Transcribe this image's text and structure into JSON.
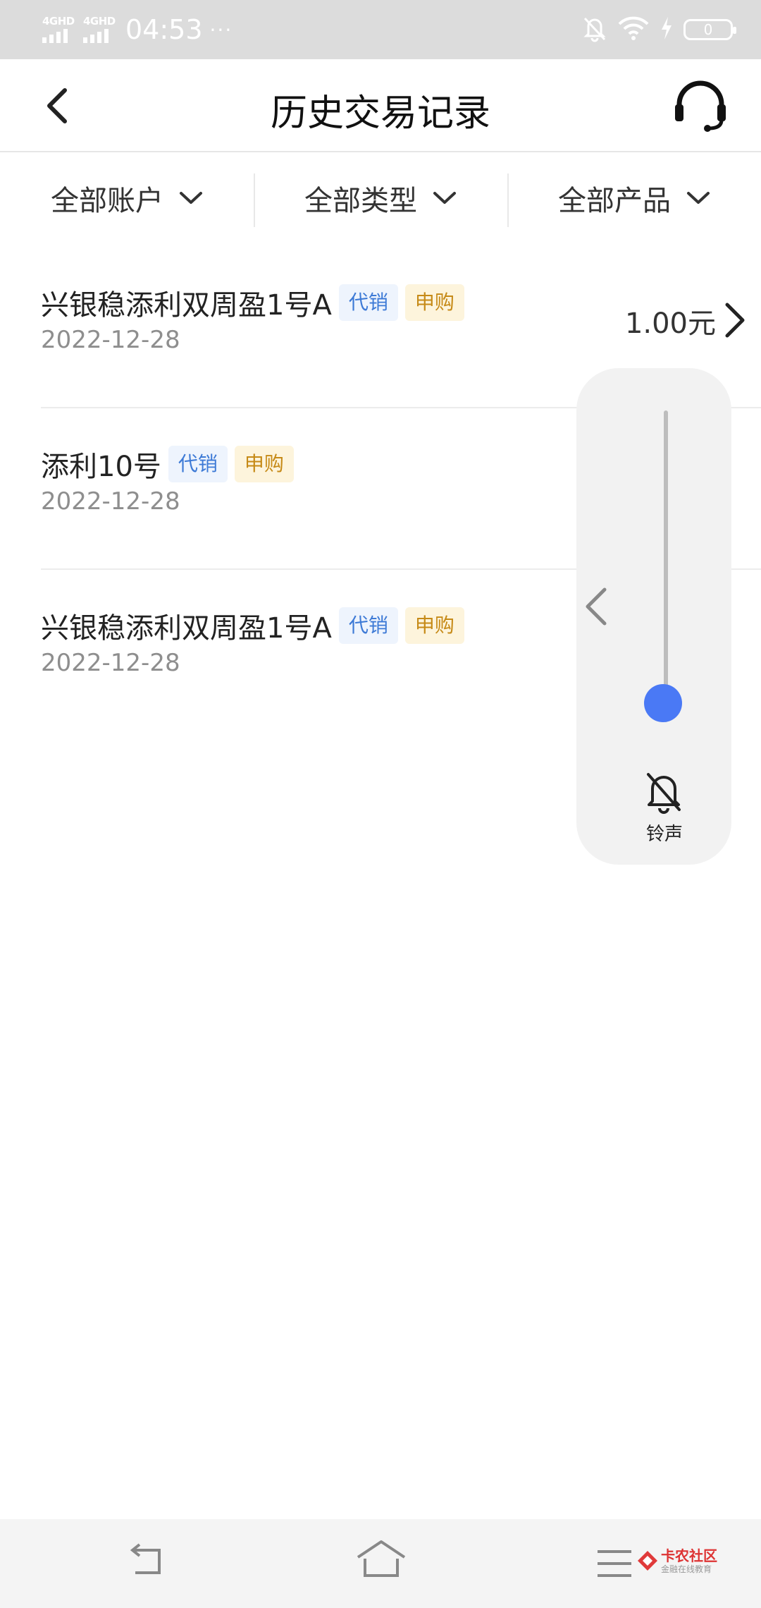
{
  "status_bar": {
    "network_1": "4GHD",
    "network_2": "4GHD",
    "time": "04:53",
    "more": "···",
    "battery": "0"
  },
  "header": {
    "title": "历史交易记录"
  },
  "filters": [
    {
      "label": "全部账户"
    },
    {
      "label": "全部类型"
    },
    {
      "label": "全部产品"
    }
  ],
  "records": [
    {
      "name": "兴银稳添利双周盈1号A",
      "tag_agent": "代销",
      "tag_type": "申购",
      "date": "2022-12-28",
      "amount": "1.00元"
    },
    {
      "name": "添利10号",
      "tag_agent": "代销",
      "tag_type": "申购",
      "date": "2022-12-28",
      "amount": ""
    },
    {
      "name": "兴银稳添利双周盈1号A",
      "tag_agent": "代销",
      "tag_type": "申购",
      "date": "2022-12-28",
      "amount": ""
    }
  ],
  "volume_overlay": {
    "label": "铃声",
    "level": 0,
    "accent": "#4a79f5"
  },
  "watermark": {
    "title": "卡农社区",
    "subtitle": "金融在线教育"
  },
  "icons": [
    "back-arrow-icon",
    "headset-icon",
    "chevron-down-icon",
    "chevron-right-icon",
    "bell-off-icon",
    "wifi-icon",
    "charging-icon",
    "battery-icon"
  ]
}
